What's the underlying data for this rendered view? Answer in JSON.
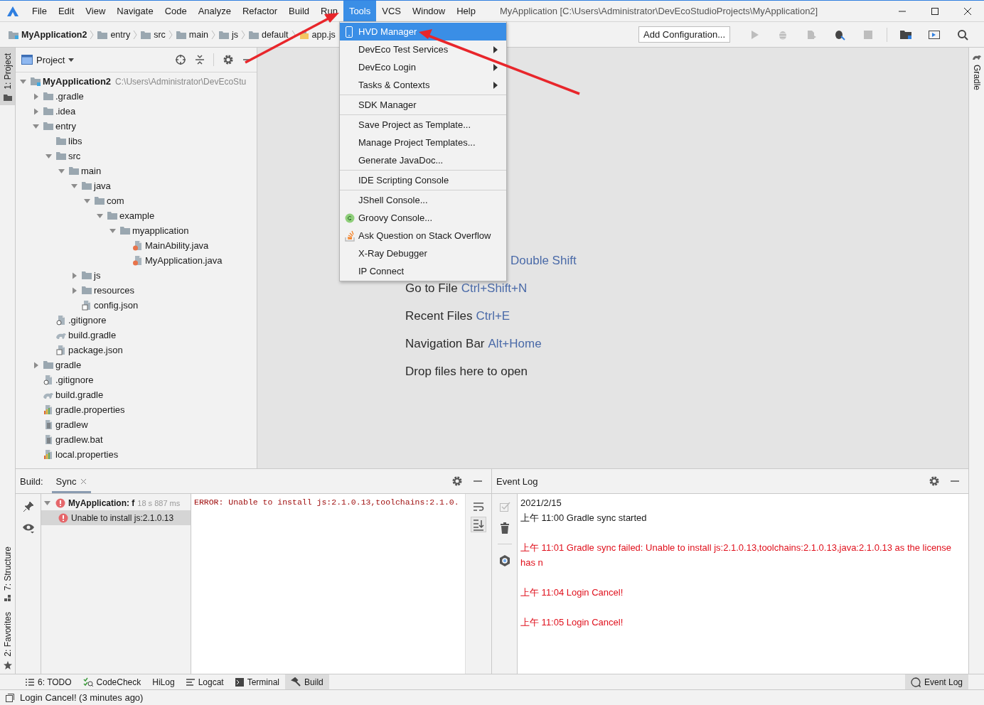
{
  "menubar": {
    "items": [
      {
        "label": "File",
        "selected": false
      },
      {
        "label": "Edit",
        "selected": false
      },
      {
        "label": "View",
        "selected": false
      },
      {
        "label": "Navigate",
        "selected": false
      },
      {
        "label": "Code",
        "selected": false
      },
      {
        "label": "Analyze",
        "selected": false
      },
      {
        "label": "Refactor",
        "selected": false
      },
      {
        "label": "Build",
        "selected": false
      },
      {
        "label": "Run",
        "selected": false
      },
      {
        "label": "Tools",
        "selected": true
      },
      {
        "label": "VCS",
        "selected": false
      },
      {
        "label": "Window",
        "selected": false
      },
      {
        "label": "Help",
        "selected": false
      }
    ],
    "title": "MyApplication [C:\\Users\\Administrator\\DevEcoStudioProjects\\MyApplication2]"
  },
  "breadcrumbs": [
    {
      "label": "MyApplication2",
      "kind": "module"
    },
    {
      "label": "entry",
      "kind": "folder"
    },
    {
      "label": "src",
      "kind": "folder"
    },
    {
      "label": "main",
      "kind": "folder"
    },
    {
      "label": "js",
      "kind": "folder"
    },
    {
      "label": "default",
      "kind": "folder"
    },
    {
      "label": "app.js",
      "kind": "js"
    }
  ],
  "run_config": "Add Configuration...",
  "toolbar": [
    {
      "kind": "run",
      "disabled": true
    },
    {
      "kind": "debug",
      "disabled": true
    },
    {
      "kind": "attach",
      "disabled": true
    },
    {
      "kind": "debug-attach",
      "disabled": false
    },
    {
      "kind": "stop",
      "disabled": true
    },
    {
      "kind": "structure",
      "disabled": false
    },
    {
      "kind": "device",
      "disabled": false
    },
    {
      "kind": "search",
      "disabled": false
    }
  ],
  "left_stripe": {
    "top": [
      {
        "label": "1: Project",
        "selected": true
      }
    ],
    "bottom": [
      {
        "label": "7: Structure",
        "selected": false
      },
      {
        "label": "2: Favorites",
        "selected": false
      }
    ]
  },
  "right_stripe": [
    {
      "label": "Gradle",
      "selected": false
    }
  ],
  "project": {
    "title": "Project",
    "tree": [
      {
        "label": "MyApplication2",
        "path": "C:\\Users\\Administrator\\DevEcoStu",
        "kind": "module",
        "expanded": true,
        "children": [
          {
            "label": ".gradle",
            "kind": "folder",
            "expanded": false
          },
          {
            "label": ".idea",
            "kind": "folder",
            "expanded": false
          },
          {
            "label": "entry",
            "kind": "folder",
            "expanded": true,
            "children": [
              {
                "label": "libs",
                "kind": "folder"
              },
              {
                "label": "src",
                "kind": "folder",
                "expanded": true,
                "children": [
                  {
                    "label": "main",
                    "kind": "folder",
                    "expanded": true,
                    "children": [
                      {
                        "label": "java",
                        "kind": "folder",
                        "expanded": true,
                        "children": [
                          {
                            "label": "com",
                            "kind": "folder",
                            "expanded": true,
                            "children": [
                              {
                                "label": "example",
                                "kind": "folder",
                                "expanded": true,
                                "children": [
                                  {
                                    "label": "myapplication",
                                    "kind": "folder",
                                    "expanded": true,
                                    "children": [
                                      {
                                        "label": "MainAbility.java",
                                        "kind": "java"
                                      },
                                      {
                                        "label": "MyApplication.java",
                                        "kind": "java"
                                      }
                                    ]
                                  }
                                ]
                              }
                            ]
                          }
                        ]
                      },
                      {
                        "label": "js",
                        "kind": "folder",
                        "expanded": false
                      },
                      {
                        "label": "resources",
                        "kind": "folder",
                        "expanded": false
                      },
                      {
                        "label": "config.json",
                        "kind": "json"
                      }
                    ]
                  }
                ]
              },
              {
                "label": ".gitignore",
                "kind": "ignore"
              },
              {
                "label": "build.gradle",
                "kind": "gradle"
              },
              {
                "label": "package.json",
                "kind": "json"
              }
            ]
          },
          {
            "label": "gradle",
            "kind": "folder",
            "expanded": false
          },
          {
            "label": ".gitignore",
            "kind": "ignore"
          },
          {
            "label": "build.gradle",
            "kind": "gradle"
          },
          {
            "label": "gradle.properties",
            "kind": "properties"
          },
          {
            "label": "gradlew",
            "kind": "script"
          },
          {
            "label": "gradlew.bat",
            "kind": "script"
          },
          {
            "label": "local.properties",
            "kind": "properties"
          }
        ]
      }
    ]
  },
  "editor": {
    "hints": [
      {
        "shortcut": "Double Shift"
      },
      {
        "action": "Go to File",
        "shortcut": "Ctrl+Shift+N"
      },
      {
        "action": "Recent Files",
        "shortcut": "Ctrl+E"
      },
      {
        "action": "Navigation Bar",
        "shortcut": "Alt+Home"
      }
    ],
    "drop_hint": "Drop files here to open"
  },
  "tools_menu": {
    "sections": [
      [
        {
          "label": "HVD Manager",
          "kind": "device",
          "selected": true
        },
        {
          "label": "DevEco Test Services",
          "kind": "submenu",
          "selected": false
        },
        {
          "label": "DevEco Login",
          "kind": "submenu",
          "selected": false
        },
        {
          "label": "Tasks & Contexts",
          "kind": "submenu",
          "selected": false
        }
      ],
      [
        {
          "label": "SDK Manager",
          "kind": "plain",
          "selected": false
        }
      ],
      [
        {
          "label": "Save Project as Template...",
          "kind": "plain",
          "selected": false
        },
        {
          "label": "Manage Project Templates...",
          "kind": "plain",
          "selected": false
        },
        {
          "label": "Generate JavaDoc...",
          "kind": "plain",
          "selected": false
        }
      ],
      [
        {
          "label": "IDE Scripting Console",
          "kind": "plain",
          "selected": false
        }
      ],
      [
        {
          "label": "JShell Console...",
          "kind": "plain",
          "selected": false
        },
        {
          "label": "Groovy Console...",
          "kind": "groovy",
          "selected": false
        },
        {
          "label": "Ask Question on Stack Overflow",
          "kind": "stack",
          "selected": false
        },
        {
          "label": "X-Ray Debugger",
          "kind": "plain",
          "selected": false
        },
        {
          "label": "IP Connect",
          "kind": "plain",
          "selected": false
        }
      ]
    ]
  },
  "build": {
    "label": "Build:",
    "tabs": [
      {
        "label": "Sync",
        "selected": true
      }
    ],
    "tree": [
      {
        "label": "MyApplication: f",
        "time": "18 s 887 ms",
        "error": true,
        "expanded": true,
        "selected": false,
        "children": [
          {
            "label": "Unable to install js:2.1.0.13",
            "error": true,
            "selected": true
          }
        ]
      }
    ],
    "console": "ERROR: Unable to install js:2.1.0.13,toolchains:2.1.0."
  },
  "event_log": {
    "title": "Event Log",
    "date": "2021/2/15",
    "entries": [
      {
        "time": "上午 11:00",
        "message": "Gradle sync started",
        "error": false
      },
      {
        "time": "上午 11:01",
        "message": "Gradle sync failed: Unable to install js:2.1.0.13,toolchains:2.1.0.13,java:2.1.0.13 as the license has n",
        "error": true
      },
      {
        "time": "上午 11:04",
        "message": "Login Cancel!",
        "error": true
      },
      {
        "time": "上午 11:05",
        "message": "Login Cancel!",
        "error": true
      }
    ]
  },
  "tool_windows": {
    "left": [
      {
        "label": "6: TODO",
        "kind": "list",
        "selected": false
      },
      {
        "label": "CodeCheck",
        "kind": "check",
        "selected": false
      },
      {
        "label": "HiLog",
        "kind": "none",
        "selected": false
      },
      {
        "label": "Logcat",
        "kind": "lines",
        "selected": false
      },
      {
        "label": "Terminal",
        "kind": "terminal",
        "selected": false
      },
      {
        "label": "Build",
        "kind": "hammer",
        "selected": true
      }
    ],
    "right": [
      {
        "label": "Event Log",
        "kind": "bubble",
        "selected": true
      }
    ]
  },
  "status_bar": {
    "message": "Login Cancel! (3 minutes ago)"
  }
}
